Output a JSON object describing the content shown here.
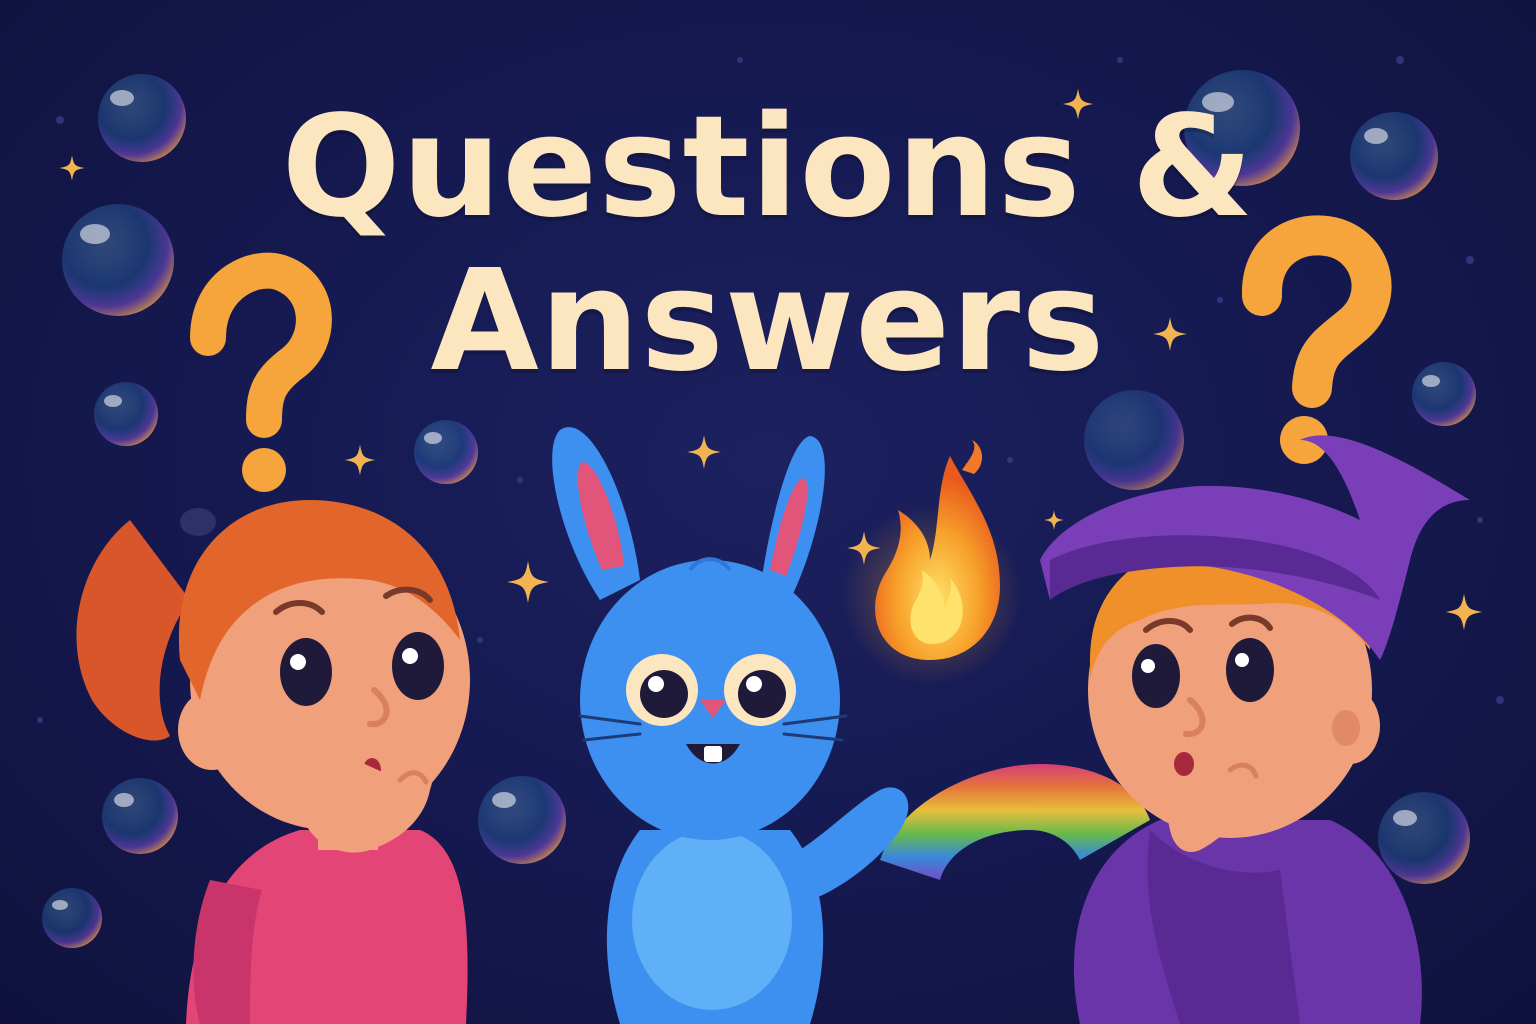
{
  "title": {
    "line1": "Questions &",
    "line2": "Answers"
  },
  "colors": {
    "background": "#161a52",
    "title_text": "#fbe6bf",
    "question_mark": "#f6a43c",
    "sparkle": "#f1b451",
    "bunny": "#3d8ff0",
    "girl_shirt": "#e24576",
    "girl_hair": "#e2652c",
    "wizard_hat": "#7a3fb8",
    "flame": "#f5862a"
  },
  "icons": [
    "question-mark-icon",
    "sparkle-icon",
    "bubble-icon",
    "flame-icon",
    "rainbow-icon"
  ]
}
